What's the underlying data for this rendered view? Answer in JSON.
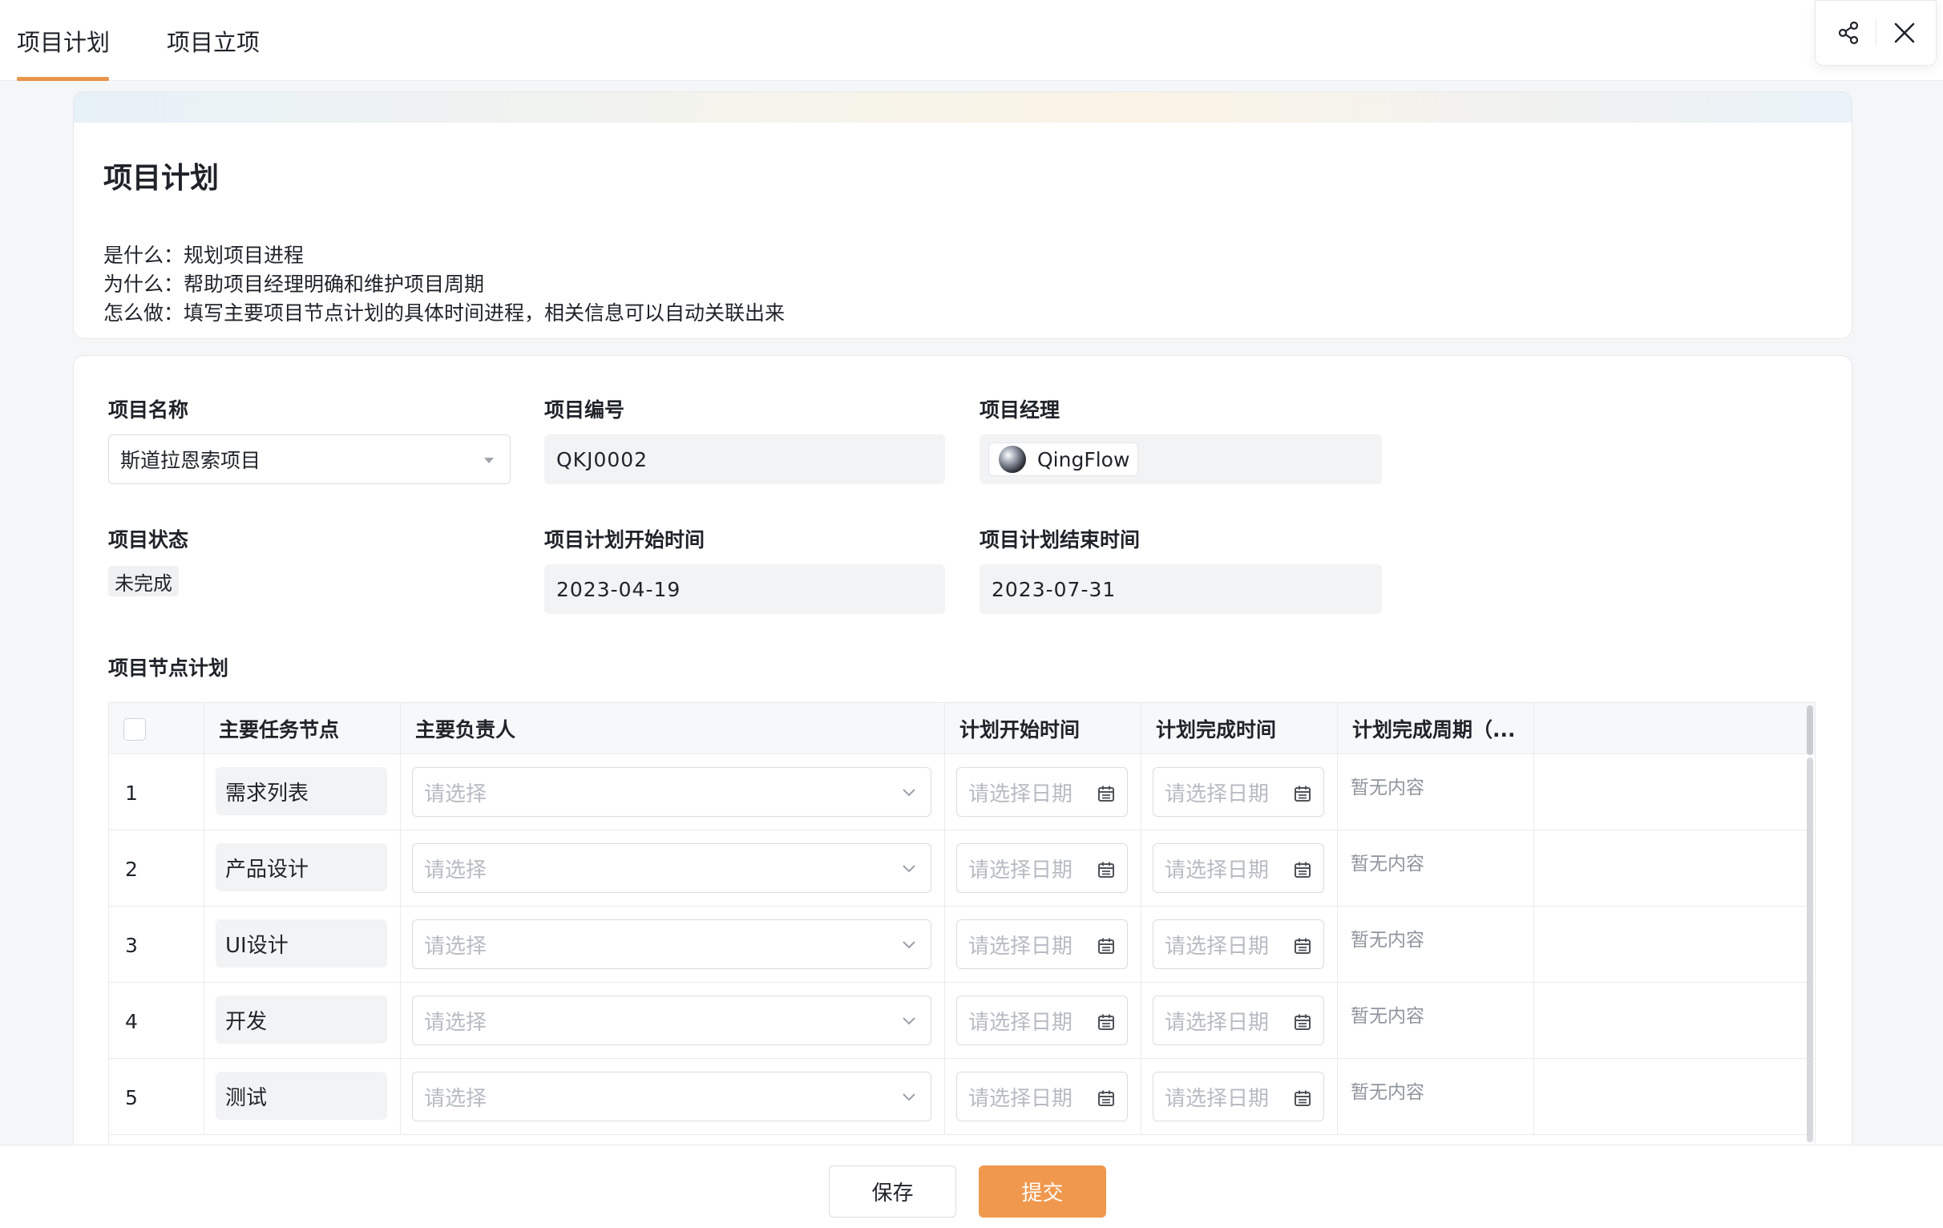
{
  "tabs": [
    {
      "label": "项目计划",
      "active": true
    },
    {
      "label": "项目立项",
      "active": false
    }
  ],
  "header_actions": {
    "share_icon": "share-icon",
    "close_icon": "close-icon"
  },
  "intro": {
    "title": "项目计划",
    "what": "是什么：规划项目进程",
    "why": "为什么：帮助项目经理明确和维护项目周期",
    "how": "怎么做：填写主要项目节点计划的具体时间进程，相关信息可以自动关联出来"
  },
  "form": {
    "project_name": {
      "label": "项目名称",
      "value": "斯道拉恩索项目"
    },
    "project_code": {
      "label": "项目编号",
      "value": "QKJ0002"
    },
    "project_manager": {
      "label": "项目经理",
      "value": "QingFlow"
    },
    "project_status": {
      "label": "项目状态",
      "value": "未完成"
    },
    "plan_start": {
      "label": "项目计划开始时间",
      "value": "2023-04-19"
    },
    "plan_end": {
      "label": "项目计划结束时间",
      "value": "2023-07-31"
    }
  },
  "node_plan": {
    "title": "项目节点计划",
    "columns": [
      "主要任务节点",
      "主要负责人",
      "计划开始时间",
      "计划完成时间",
      "计划完成周期（..."
    ],
    "rows": [
      {
        "num": "1",
        "task": "需求列表",
        "owner_placeholder": "请选择",
        "start_placeholder": "请选择日期",
        "end_placeholder": "请选择日期",
        "cycle": "暂无内容"
      },
      {
        "num": "2",
        "task": "产品设计",
        "owner_placeholder": "请选择",
        "start_placeholder": "请选择日期",
        "end_placeholder": "请选择日期",
        "cycle": "暂无内容"
      },
      {
        "num": "3",
        "task": "UI设计",
        "owner_placeholder": "请选择",
        "start_placeholder": "请选择日期",
        "end_placeholder": "请选择日期",
        "cycle": "暂无内容"
      },
      {
        "num": "4",
        "task": "开发",
        "owner_placeholder": "请选择",
        "start_placeholder": "请选择日期",
        "end_placeholder": "请选择日期",
        "cycle": "暂无内容"
      },
      {
        "num": "5",
        "task": "测试",
        "owner_placeholder": "请选择",
        "start_placeholder": "请选择日期",
        "end_placeholder": "请选择日期",
        "cycle": "暂无内容"
      }
    ]
  },
  "footer": {
    "save_label": "保存",
    "submit_label": "提交"
  },
  "colors": {
    "accent": "#f0984d",
    "tab_underline": "#e8944a"
  }
}
